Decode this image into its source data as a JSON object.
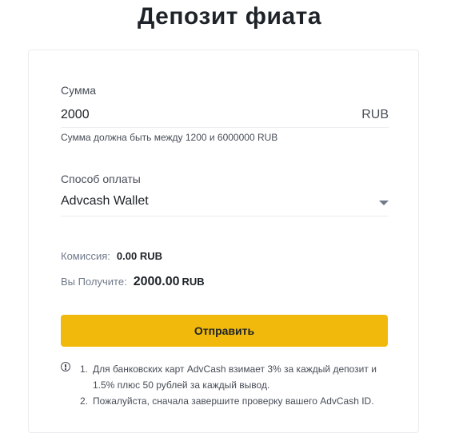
{
  "page": {
    "title": "Депозит фиата"
  },
  "amount": {
    "label": "Сумма",
    "value": "2000",
    "currency": "RUB",
    "hint": "Сумма должна быть между 1200 и 6000000 RUB"
  },
  "payment": {
    "label": "Способ оплаты",
    "selected": "Advcash Wallet",
    "icon": "chevron-down-icon"
  },
  "summary": {
    "fee_label": "Комиссия:",
    "fee_value": "0.00 RUB",
    "receive_label": "Вы Получите:",
    "receive_amount": "2000.00",
    "receive_currency": "RUB"
  },
  "submit": {
    "label": "Отправить",
    "color": "#f0b90b"
  },
  "notes": {
    "icon": "info-icon",
    "items": [
      {
        "num": "1.",
        "text": "Для банковских карт AdvCash взимает 3% за каждый депозит и 1.5% плюс 50 рублей за каждый вывод."
      },
      {
        "num": "2.",
        "text": "Пожалуйста, сначала завершите проверку вашего AdvCash ID."
      }
    ]
  }
}
